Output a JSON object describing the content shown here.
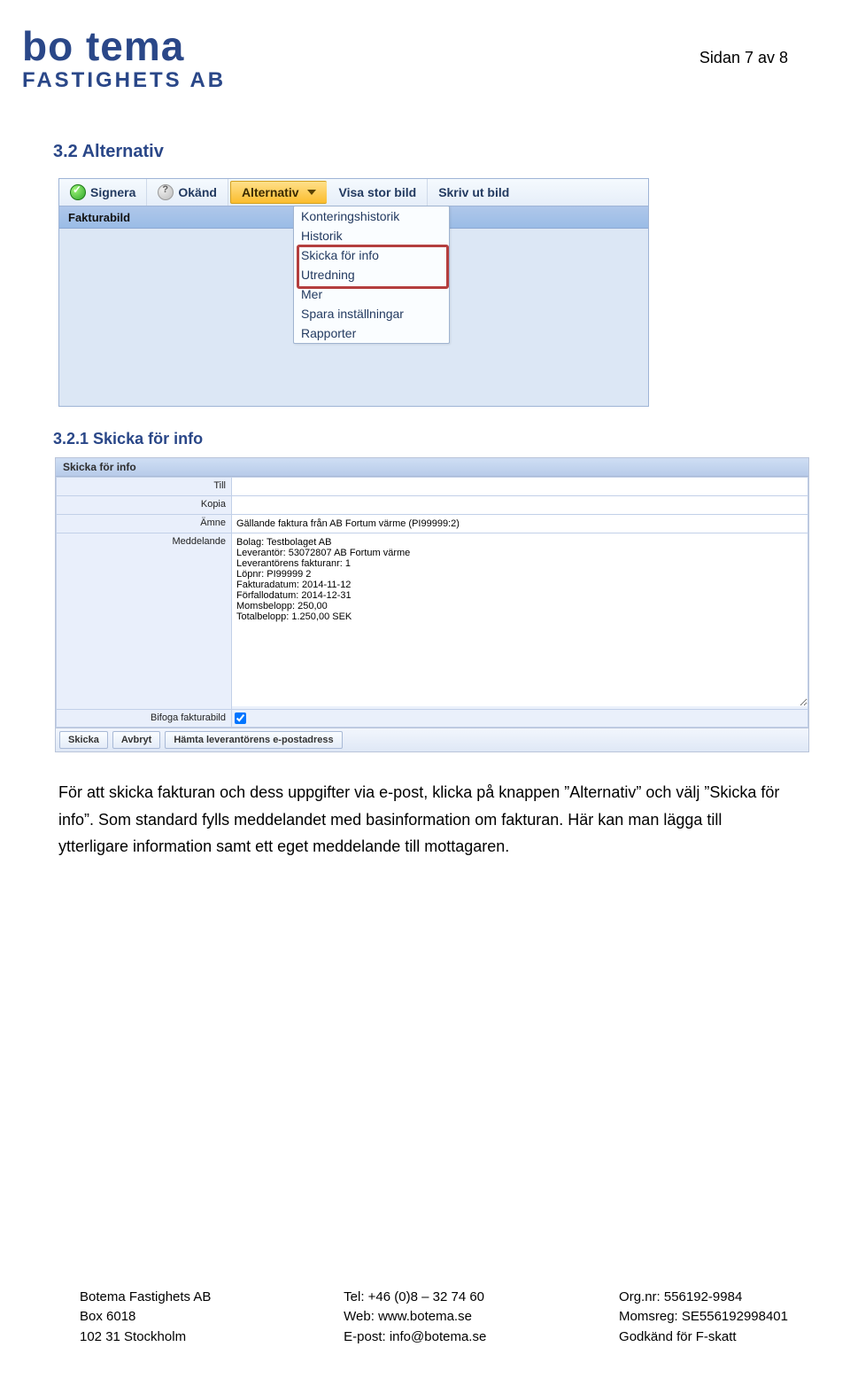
{
  "page_number": "Sidan 7 av 8",
  "logo": {
    "line1": "bo tema",
    "line2": "FASTIGHETS AB"
  },
  "section_heading": "3.2  Alternativ",
  "subsection_heading": "3.2.1  Skicka för info",
  "toolbar": {
    "signera": "Signera",
    "okand": "Okänd",
    "alternativ": "Alternativ",
    "visa_stor_bild": "Visa stor bild",
    "skriv_ut_bild": "Skriv ut bild"
  },
  "panel1_header": "Fakturabild",
  "dropdown": {
    "konteringshistorik": "Konteringshistorik",
    "historik": "Historik",
    "skicka_for_info": "Skicka för info",
    "utredning": "Utredning",
    "mer": "Mer",
    "spara_installningar": "Spara inställningar",
    "rapporter": "Rapporter"
  },
  "form": {
    "panel_title": "Skicka för info",
    "labels": {
      "till": "Till",
      "kopia": "Kopia",
      "amne": "Ämne",
      "meddelande": "Meddelande",
      "bifoga": "Bifoga fakturabild"
    },
    "values": {
      "till": "",
      "kopia": "",
      "amne": "Gällande faktura från AB Fortum värme (PI99999:2)",
      "meddelande": "Bolag: Testbolaget AB\nLeverantör: 53072807 AB Fortum värme\nLeverantörens fakturanr: 1\nLöpnr: PI99999 2\nFakturadatum: 2014-11-12\nFörfallodatum: 2014-12-31\nMomsbelopp: 250,00\nTotalbelopp: 1.250,00 SEK"
    },
    "buttons": {
      "skicka": "Skicka",
      "avbryt": "Avbryt",
      "hamta": "Hämta leverantörens e-postadress"
    }
  },
  "body_paragraph": "För att skicka fakturan och dess uppgifter via e-post, klicka på knappen ”Alternativ” och välj ”Skicka för info”. Som standard fylls meddelandet med basinformation om fakturan. Här kan man lägga till ytterligare information samt ett eget meddelande till mottagaren.",
  "footer": {
    "col1": "Botema Fastighets AB\nBox 6018\n102 31 Stockholm",
    "col2": "Tel: +46 (0)8 – 32 74 60\nWeb: www.botema.se\nE-post: info@botema.se",
    "col3": "Org.nr: 556192-9984\nMomsreg: SE556192998401\nGodkänd för F-skatt"
  }
}
